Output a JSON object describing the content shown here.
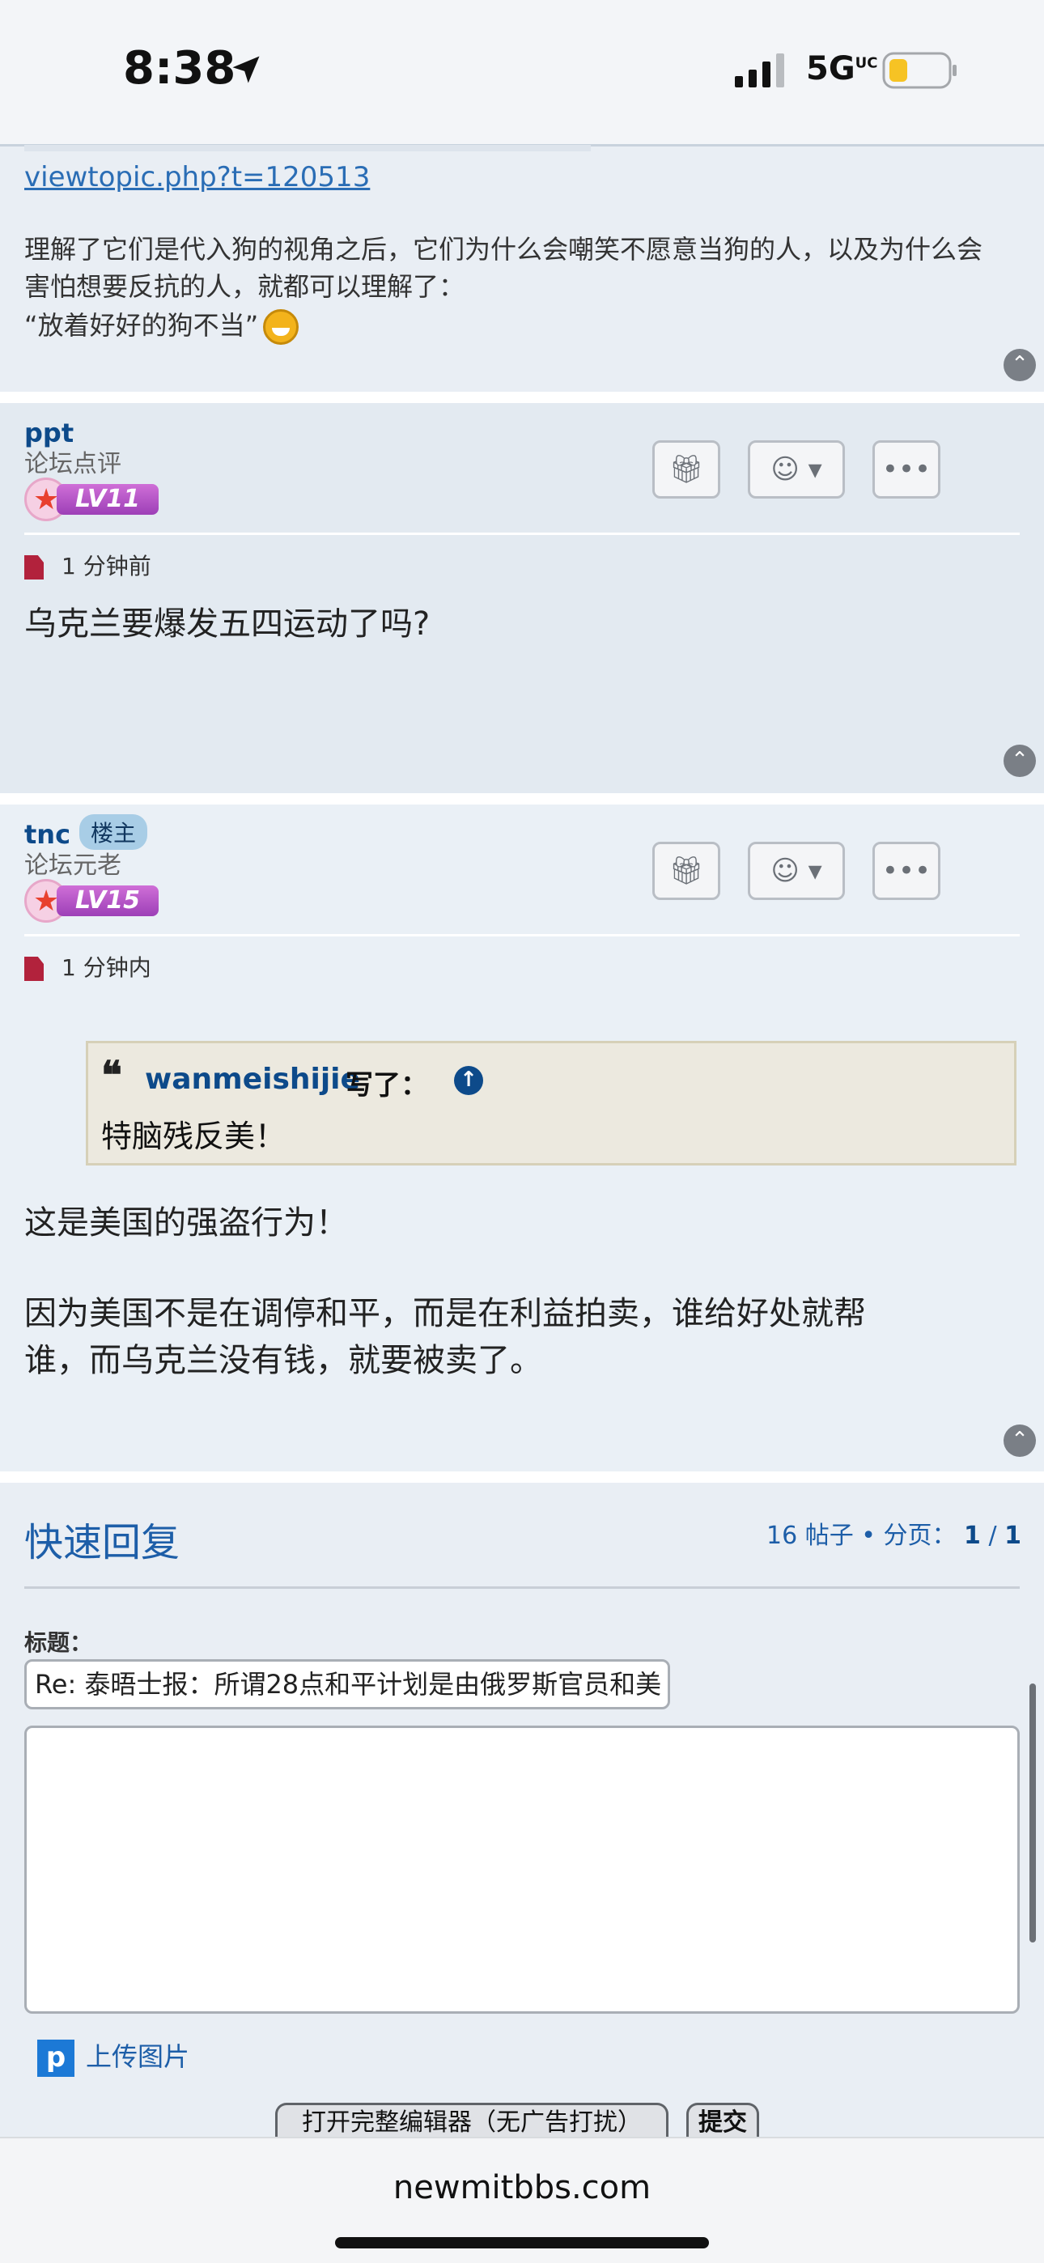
{
  "status": {
    "time": "8:38",
    "network": "5G",
    "network_sup": "UC"
  },
  "post_top": {
    "link": "viewtopic.php?t=120513",
    "para1_line1": "理解了它们是代入狗的视角之后，它们为什么会嘲笑不愿意当狗的人，以及为什么会",
    "para1_line2": "害怕想要反抗的人，就都可以理解了：",
    "quote_line": "“放着好好的狗不当”"
  },
  "posts": [
    {
      "username": "ppt",
      "rank": "论坛点评",
      "level": "LV11",
      "time": "1 分钟前",
      "body": "乌克兰要爆发五四运动了吗?"
    },
    {
      "username": "tnc",
      "op_badge": "楼主",
      "rank": "论坛元老",
      "level": "LV15",
      "time": "1 分钟内",
      "quote_author": "wanmeishijie",
      "quote_wrote": "写了：",
      "quote_text": "特脑残反美！",
      "body_line1": "这是美国的强盗行为！",
      "body_line2": "因为美国不是在调停和平，而是在利益拍卖，谁给好处就帮",
      "body_line3": "谁，而乌克兰没有钱，就要被卖了。"
    }
  ],
  "reply": {
    "title": "快速回复",
    "post_count": "16 帖子",
    "page_label": "分页：",
    "page_current": "1",
    "page_sep": "/",
    "page_total": "1",
    "subject_label": "标题：",
    "subject_value": "Re: 泰晤士报：所谓28点和平计划是由俄罗斯官员和美",
    "upload_label": "上传图片",
    "full_editor_label": "打开完整编辑器（无广告打扰）",
    "submit_label": "提交"
  },
  "browser": {
    "url": "newmitbbs.com"
  }
}
